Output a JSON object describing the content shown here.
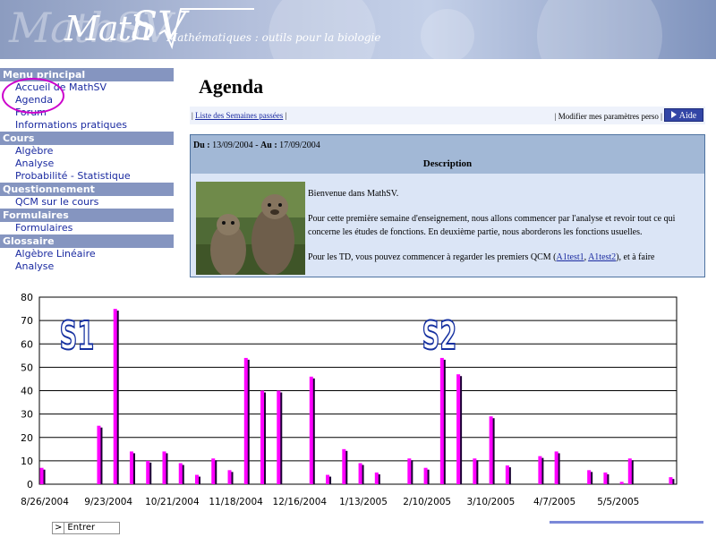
{
  "banner": {
    "logo_ghost": "MathSV",
    "logo_main": "Math",
    "logo_sv": "SV",
    "subtitle": "Mathématiques : outils pour la biologie"
  },
  "sidebar": {
    "sections": [
      {
        "header": "Menu principal",
        "items": [
          "Accueil de MathSV",
          "Agenda",
          "Forum",
          "Informations pratiques"
        ]
      },
      {
        "header": "Cours",
        "items": [
          "Algèbre",
          "Analyse",
          "Probabilité - Statistique"
        ]
      },
      {
        "header": "Questionnement",
        "items": [
          "QCM sur le cours"
        ]
      },
      {
        "header": "Formulaires",
        "items": [
          "Formulaires"
        ]
      },
      {
        "header": "Glossaire",
        "items": [
          "Algèbre Linéaire",
          "Analyse"
        ]
      }
    ]
  },
  "main": {
    "title": "Agenda",
    "linkbar": {
      "left_sep": "| ",
      "past_weeks": "Liste des Semaines passées",
      "left_sep_end": " |",
      "right_prefix": "| Modifier mes paramètres perso |",
      "help_label": "Aide"
    },
    "agenda": {
      "from_label": "Du :",
      "from_date": "13/09/2004",
      "to_label": "Au :",
      "to_date": "17/09/2004",
      "description_header": "Description",
      "paragraph1": "Bienvenue dans MathSV.",
      "paragraph2": "Pour cette première semaine d'enseignement, nous allons commencer par l'analyse et revoir tout ce qui concerne les études de fonctions. En deuxième partie, nous aborderons les fonctions usuelles.",
      "paragraph3_prefix": "Pour les TD, vous pouvez commencer à regarder les premiers QCM (",
      "link1": "A1test1",
      "paragraph3_mid": ", ",
      "link2": "A1test2",
      "paragraph3_suffix": "), et à faire"
    }
  },
  "entrer": {
    "prefix": ">",
    "label": "Entrer"
  },
  "chart_data": {
    "type": "bar",
    "ylim": [
      0,
      80
    ],
    "yticks": [
      0,
      10,
      20,
      30,
      40,
      50,
      60,
      70,
      80
    ],
    "xtick_labels": [
      "8/26/2004",
      "9/23/2004",
      "10/21/2004",
      "11/18/2004",
      "12/16/2004",
      "1/13/2005",
      "2/10/2005",
      "3/10/2005",
      "4/7/2005",
      "5/5/2005"
    ],
    "annotations": [
      "S1",
      "S2"
    ],
    "colors": {
      "front": "#ff00ff",
      "shadow": "#1a0033",
      "annotation_fill": "#ffffff",
      "annotation_stroke": "#1530a0"
    },
    "series": [
      {
        "values": [
          7,
          0,
          0,
          0,
          0,
          0,
          0,
          25,
          0,
          75,
          0,
          14,
          0,
          10,
          0,
          14,
          0,
          9,
          0,
          4,
          0,
          11,
          0,
          6,
          0,
          54,
          0,
          40,
          0,
          40,
          0,
          0,
          0,
          46,
          0,
          4,
          0,
          15,
          0,
          9,
          0,
          5,
          0,
          0,
          0,
          11,
          0,
          7,
          0,
          54,
          0,
          47,
          0,
          11,
          0,
          29,
          0,
          8,
          0,
          0,
          0,
          12,
          0,
          14,
          0,
          0,
          0,
          6,
          0,
          5,
          0,
          1,
          11,
          0,
          0,
          0,
          0,
          3
        ]
      }
    ]
  }
}
